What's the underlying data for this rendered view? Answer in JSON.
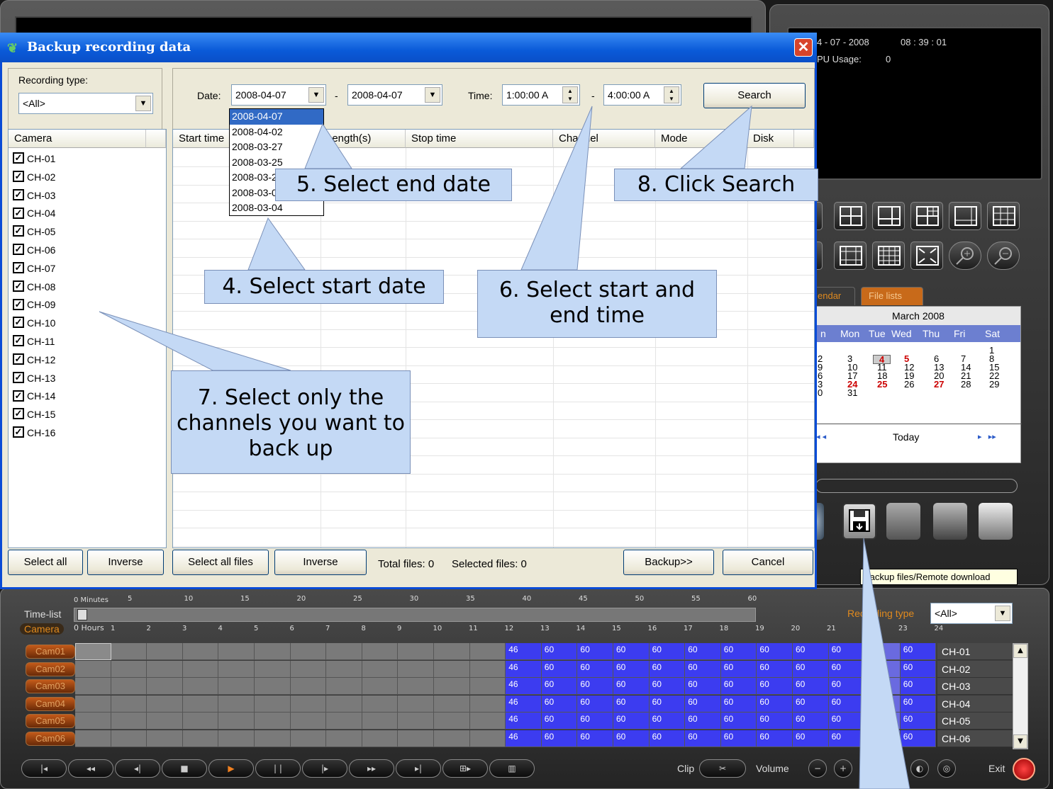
{
  "dialog": {
    "title": "Backup recording data",
    "close": "✕",
    "recording_type_label": "Recording type:",
    "recording_type_value": "<All>",
    "date_label": "Date:",
    "date_start": "2008-04-07",
    "date_sep": "-",
    "date_end": "2008-04-07",
    "time_label": "Time:",
    "time_start": "1:00:00 A",
    "time_sep": "-",
    "time_end": "4:00:00 A",
    "search_label": "Search",
    "date_options": [
      "2008-04-07",
      "2008-04-02",
      "2008-03-27",
      "2008-03-25",
      "2008-03-24",
      "2008-03-05",
      "2008-03-04"
    ],
    "camera_header": "Camera",
    "cameras": [
      "CH-01",
      "CH-02",
      "CH-03",
      "CH-04",
      "CH-05",
      "CH-06",
      "CH-07",
      "CH-08",
      "CH-09",
      "CH-10",
      "CH-11",
      "CH-12",
      "CH-13",
      "CH-14",
      "CH-15",
      "CH-16"
    ],
    "columns": [
      "Start time",
      "Length(s)",
      "Stop time",
      "Channel",
      "Mode",
      "Disk"
    ],
    "select_all": "Select all",
    "inverse": "Inverse",
    "select_all_files": "Select all files",
    "inverse_files": "Inverse",
    "total_files": "Total files: 0",
    "selected_files": "Selected files: 0",
    "backup": "Backup>>",
    "cancel": "Cancel"
  },
  "callouts": {
    "c4": "4. Select start date",
    "c5": "5. Select end date",
    "c6": "6. Select start and end time",
    "c7": "7. Select only the channels you want to back up",
    "c8": "8. Click Search"
  },
  "info": {
    "date": "4 - 07 - 2008",
    "time": "08 : 39 : 01",
    "cpu_label": "PU Usage:",
    "cpu_value": "0"
  },
  "tabs": [
    "endar",
    "File lists"
  ],
  "calendar": {
    "month": "March 2008",
    "dow": [
      "n",
      "Mon",
      "Tue",
      "Wed",
      "Thu",
      "Fri",
      "Sat"
    ],
    "rows": [
      [
        "",
        "",
        "",
        "",
        "",
        "",
        "1"
      ],
      [
        "2",
        "3",
        "4",
        "5",
        "6",
        "7",
        "8"
      ],
      [
        "9",
        "10",
        "11",
        "12",
        "13",
        "14",
        "15"
      ],
      [
        "6",
        "17",
        "18",
        "19",
        "20",
        "21",
        "22"
      ],
      [
        "3",
        "24",
        "25",
        "26",
        "27",
        "28",
        "29"
      ],
      [
        "0",
        "31",
        "",
        "",
        "",
        "",
        ""
      ]
    ],
    "today": "Today"
  },
  "tooltip": "Backup files/Remote download",
  "timeline": {
    "minutes_label": "0 Minutes",
    "minute_ticks": [
      "5",
      "10",
      "15",
      "20",
      "25",
      "30",
      "35",
      "40",
      "45",
      "50",
      "55",
      "60"
    ],
    "time_list": "Time-list",
    "camera_label": "Camera",
    "hours_label": "0 Hours",
    "hour_ticks": [
      "1",
      "2",
      "3",
      "4",
      "5",
      "6",
      "7",
      "8",
      "9",
      "10",
      "11",
      "12",
      "13",
      "14",
      "15",
      "16",
      "17",
      "18",
      "19",
      "20",
      "21",
      "22",
      "23",
      "24"
    ],
    "recording_type_label": "Recording type",
    "recording_type_value": "<All>",
    "cams": [
      "Cam01",
      "Cam02",
      "Cam03",
      "Cam04",
      "Cam05",
      "Cam06"
    ],
    "channels": [
      "CH-01",
      "CH-02",
      "CH-03",
      "CH-04",
      "CH-05",
      "CH-06"
    ],
    "hour_values": [
      "46",
      "60",
      "60",
      "60",
      "60",
      "60",
      "60",
      "60",
      "60",
      "60",
      "60",
      "60"
    ],
    "clip": "Clip",
    "volume": "Volume",
    "mute": "Mute",
    "exit": "Exit"
  },
  "colors": {
    "title_blue": "#0a5ad8",
    "callout_fill": "#c4d9f5",
    "record_blue": "#3c3cf0",
    "accent_orange": "#e08a1e"
  }
}
